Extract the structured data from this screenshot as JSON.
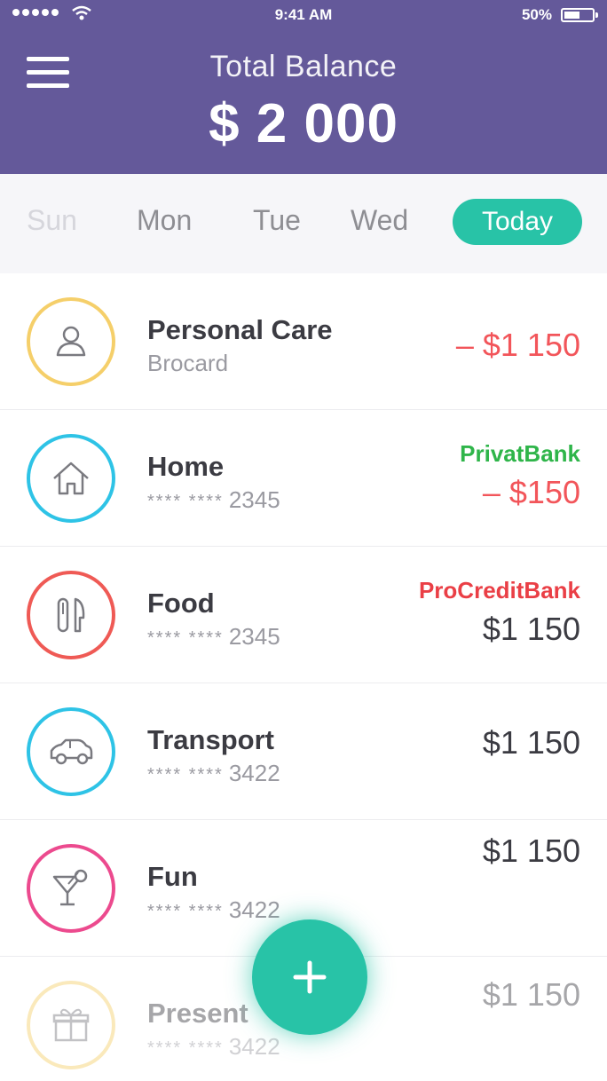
{
  "status_bar": {
    "time": "9:41 AM",
    "battery": "50%"
  },
  "header": {
    "title": "Total Balance",
    "amount": "$ 2 000"
  },
  "days": {
    "sun": "Sun",
    "mon": "Mon",
    "tue": "Tue",
    "wed": "Wed",
    "today": "Today"
  },
  "colors": {
    "header": "#64599a",
    "accent": "#28c3a7",
    "negative": "#f2555a",
    "bank_green": "#2fb54a",
    "bank_red": "#ea3f46"
  },
  "transactions": [
    {
      "icon": "person-icon",
      "name": "Personal Care",
      "sub": "Brocard",
      "bank": "",
      "amount": "– $1 150"
    },
    {
      "icon": "house-icon",
      "name": "Home",
      "card_mask": "**** ****",
      "card_last": "2345",
      "bank": "PrivatBank",
      "amount": "– $150"
    },
    {
      "icon": "fork-knife-icon",
      "name": "Food",
      "card_mask": "**** ****",
      "card_last": "2345",
      "bank": "ProCreditBank",
      "amount": "$1 150"
    },
    {
      "icon": "car-icon",
      "name": "Transport",
      "card_mask": "**** ****",
      "card_last": "3422",
      "bank": "",
      "amount": "$1 150"
    },
    {
      "icon": "cocktail-icon",
      "name": "Fun",
      "card_mask": "**** ****",
      "card_last": "3422",
      "bank": "",
      "amount": "$1 150"
    },
    {
      "icon": "gift-icon",
      "name": "Present",
      "card_mask": "**** ****",
      "card_last": "3422",
      "bank": "",
      "amount": "$1 150"
    }
  ]
}
